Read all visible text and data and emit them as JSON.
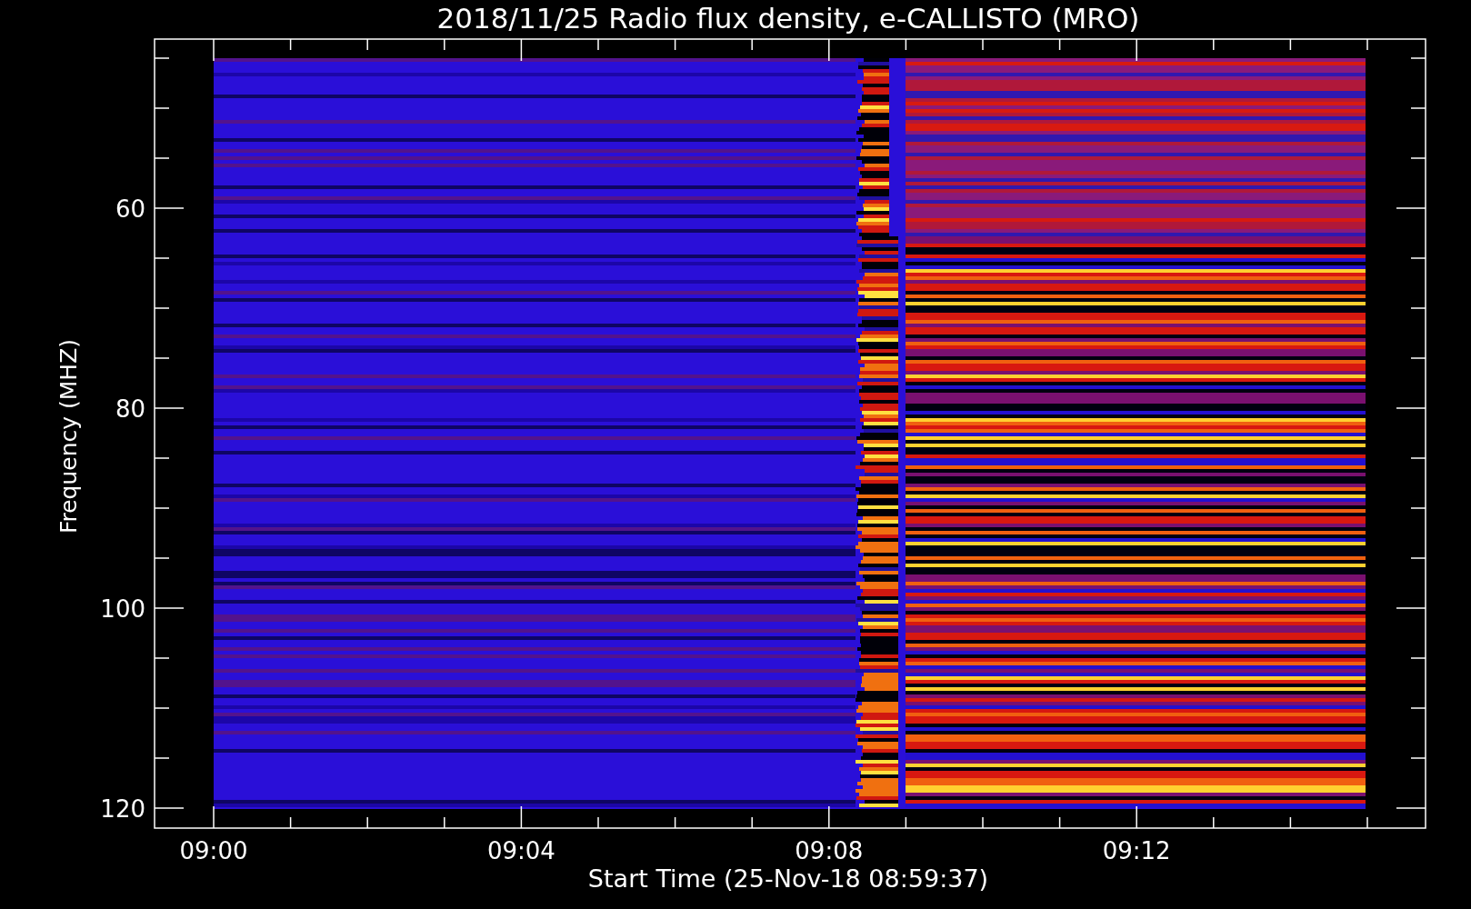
{
  "title": "2018/11/25  Radio flux density, e-CALLISTO (MRO)",
  "y_axis": {
    "label": "Frequency (MHZ)",
    "ticks": [
      "60",
      "80",
      "100",
      "120"
    ]
  },
  "x_axis": {
    "label": "Start Time (25-Nov-18 08:59:37)",
    "ticks": [
      "09:00",
      "09:04",
      "09:08",
      "09:12"
    ]
  }
}
